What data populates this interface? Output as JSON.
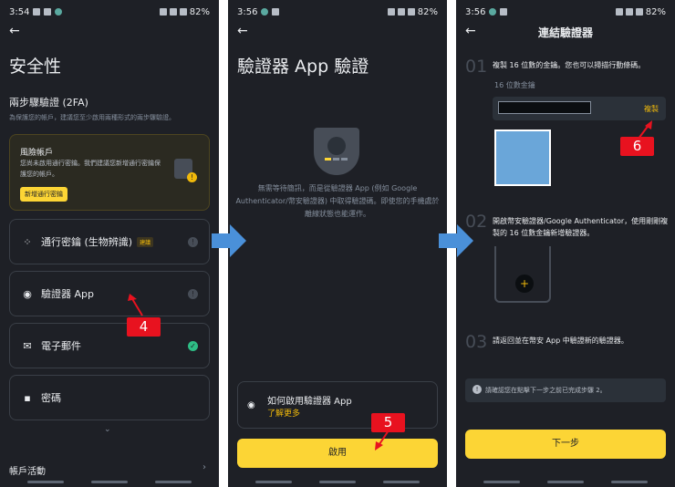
{
  "status": {
    "time1": "3:54",
    "time2": "3:56",
    "time3": "3:56",
    "battery": "82%"
  },
  "p1": {
    "title": "安全性",
    "section_2fa": "兩步驟驗證 (2FA)",
    "section_2fa_desc": "為保護您的帳戶，建議您至少啟用兩種形式的兩步驟驗證。",
    "risk_title": "風險帳戶",
    "risk_desc": "您尚未啟用通行密鑰。我們建議您新增通行密鑰保護您的帳戶。",
    "risk_btn": "新增通行密鑰",
    "items": [
      {
        "label": "通行密鑰 (生物辨識)",
        "tag": "建議"
      },
      {
        "label": "驗證器 App"
      },
      {
        "label": "電子郵件"
      },
      {
        "label": "密碼"
      }
    ],
    "activity": "帳戶活動",
    "step_marker": "4"
  },
  "p2": {
    "title": "驗證器 App 驗證",
    "desc": "無需等待簡訊，而是從驗證器 App (例如 Google Authenticator/幣安驗證器) 中取得驗證碼。即使您的手機處於離線狀態也能運作。",
    "howto": "如何啟用驗證器 App",
    "learn_more": "了解更多",
    "enable_btn": "啟用",
    "step_marker": "5"
  },
  "p3": {
    "title": "連結驗證器",
    "step1_num": "01",
    "step1_text": "複製 16 位數的金鑰。您也可以掃描行動條碼。",
    "key_label": "16 位數金鑰",
    "copy_btn": "複製",
    "step2_num": "02",
    "step2_text": "開啟幣安驗證器/Google Authenticator，使用剛剛複製的 16 位數金鑰新增驗證器。",
    "step3_num": "03",
    "step3_text": "請返回並在幣安 App 中驗證新的驗證器。",
    "notice": "請確認您在點擊下一步之前已完成步驟 2。",
    "next_btn": "下一步",
    "step_marker": "6"
  },
  "colors": {
    "bg": "#1e2026",
    "accent": "#fcd535",
    "marker": "#e8121f",
    "arrow": "#4a90d9"
  }
}
